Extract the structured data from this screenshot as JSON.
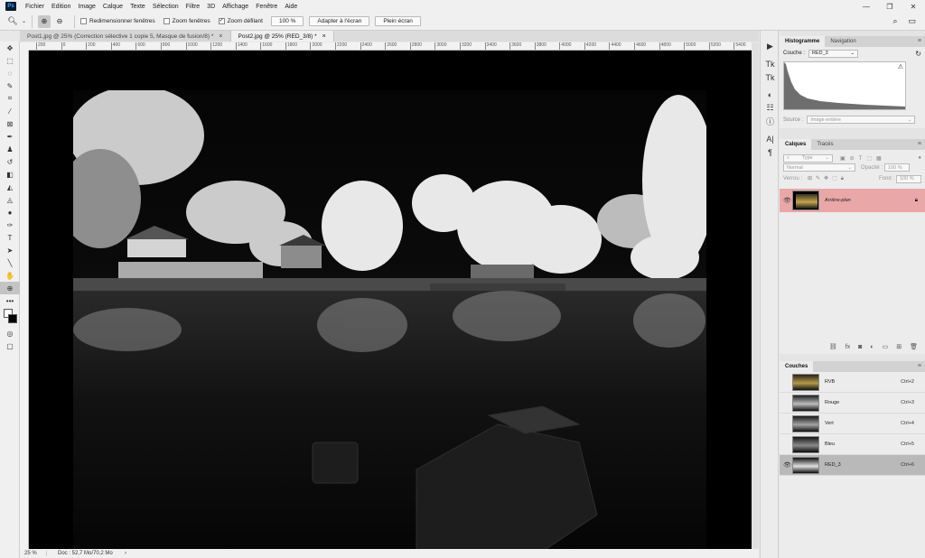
{
  "app": {
    "logo_text": "Ps"
  },
  "menu": [
    "Fichier",
    "Edition",
    "Image",
    "Calque",
    "Texte",
    "Sélection",
    "Filtre",
    "3D",
    "Affichage",
    "Fenêtre",
    "Aide"
  ],
  "window_controls": {
    "minimize": "—",
    "maximize": "❐",
    "close": "✕"
  },
  "options_bar": {
    "tool_icon": "zoom-icon",
    "checkboxes": [
      {
        "label": "Redimensionner fenêtres",
        "checked": false
      },
      {
        "label": "Zoom fenêtres",
        "checked": false
      },
      {
        "label": "Zoom défilant",
        "checked": true
      }
    ],
    "zoom_value": "100 %",
    "fit_button": "Adapter à l'écran",
    "fill_button": "Plein écran"
  },
  "doc_tabs": [
    {
      "title": "Post1.jpg @ 25% (Correction sélective 1 copie 5, Masque de fusion/8) *",
      "active": false
    },
    {
      "title": "Post2.jpg @ 25% (RED_3/8) *",
      "active": true
    }
  ],
  "ruler": {
    "h_ticks": [
      "200",
      "0",
      "200",
      "400",
      "600",
      "800",
      "1000",
      "1200",
      "1400",
      "1600",
      "1800",
      "2000",
      "2200",
      "2400",
      "2600",
      "2800",
      "3000",
      "3200",
      "3400",
      "3600",
      "3800",
      "4000",
      "4200",
      "4400",
      "4600",
      "4800",
      "5000",
      "5200",
      "5400"
    ]
  },
  "status": {
    "zoom": "25 %",
    "doc": "Doc : 52,7 Mo/70,2 Mo",
    "arrow": "›"
  },
  "histogram": {
    "tabs": [
      "Histogramme",
      "Navigation"
    ],
    "channel_label": "Couche :",
    "channel_value": "RED_3",
    "source_label": "Source :",
    "source_value": "Image entière"
  },
  "layers": {
    "tabs": [
      "Calques",
      "Tracés"
    ],
    "filter_label": "Type",
    "blend_mode": "Normal",
    "opacity_label": "Opacité :",
    "opacity_value": "100 %",
    "lock_label": "Verrou :",
    "fill_label": "Fond :",
    "fill_value": "100 %",
    "items": [
      {
        "name": "Arrière-plan",
        "selected": true
      }
    ]
  },
  "channels": {
    "tab": "Couches",
    "items": [
      {
        "name": "RVB",
        "shortcut": "Ctrl+2",
        "selected": false,
        "color": true
      },
      {
        "name": "Rouge",
        "shortcut": "Ctrl+3",
        "selected": false,
        "color": false
      },
      {
        "name": "Vert",
        "shortcut": "Ctrl+4",
        "selected": false,
        "color": false
      },
      {
        "name": "Bleu",
        "shortcut": "Ctrl+5",
        "selected": false,
        "color": false
      },
      {
        "name": "RED_3",
        "shortcut": "Ctrl+6",
        "selected": true,
        "color": false
      }
    ]
  },
  "colors": {
    "layer_selected": "#eaa7a7",
    "channel_selected": "#b9b9b9",
    "canvas_bg": "#000000"
  }
}
